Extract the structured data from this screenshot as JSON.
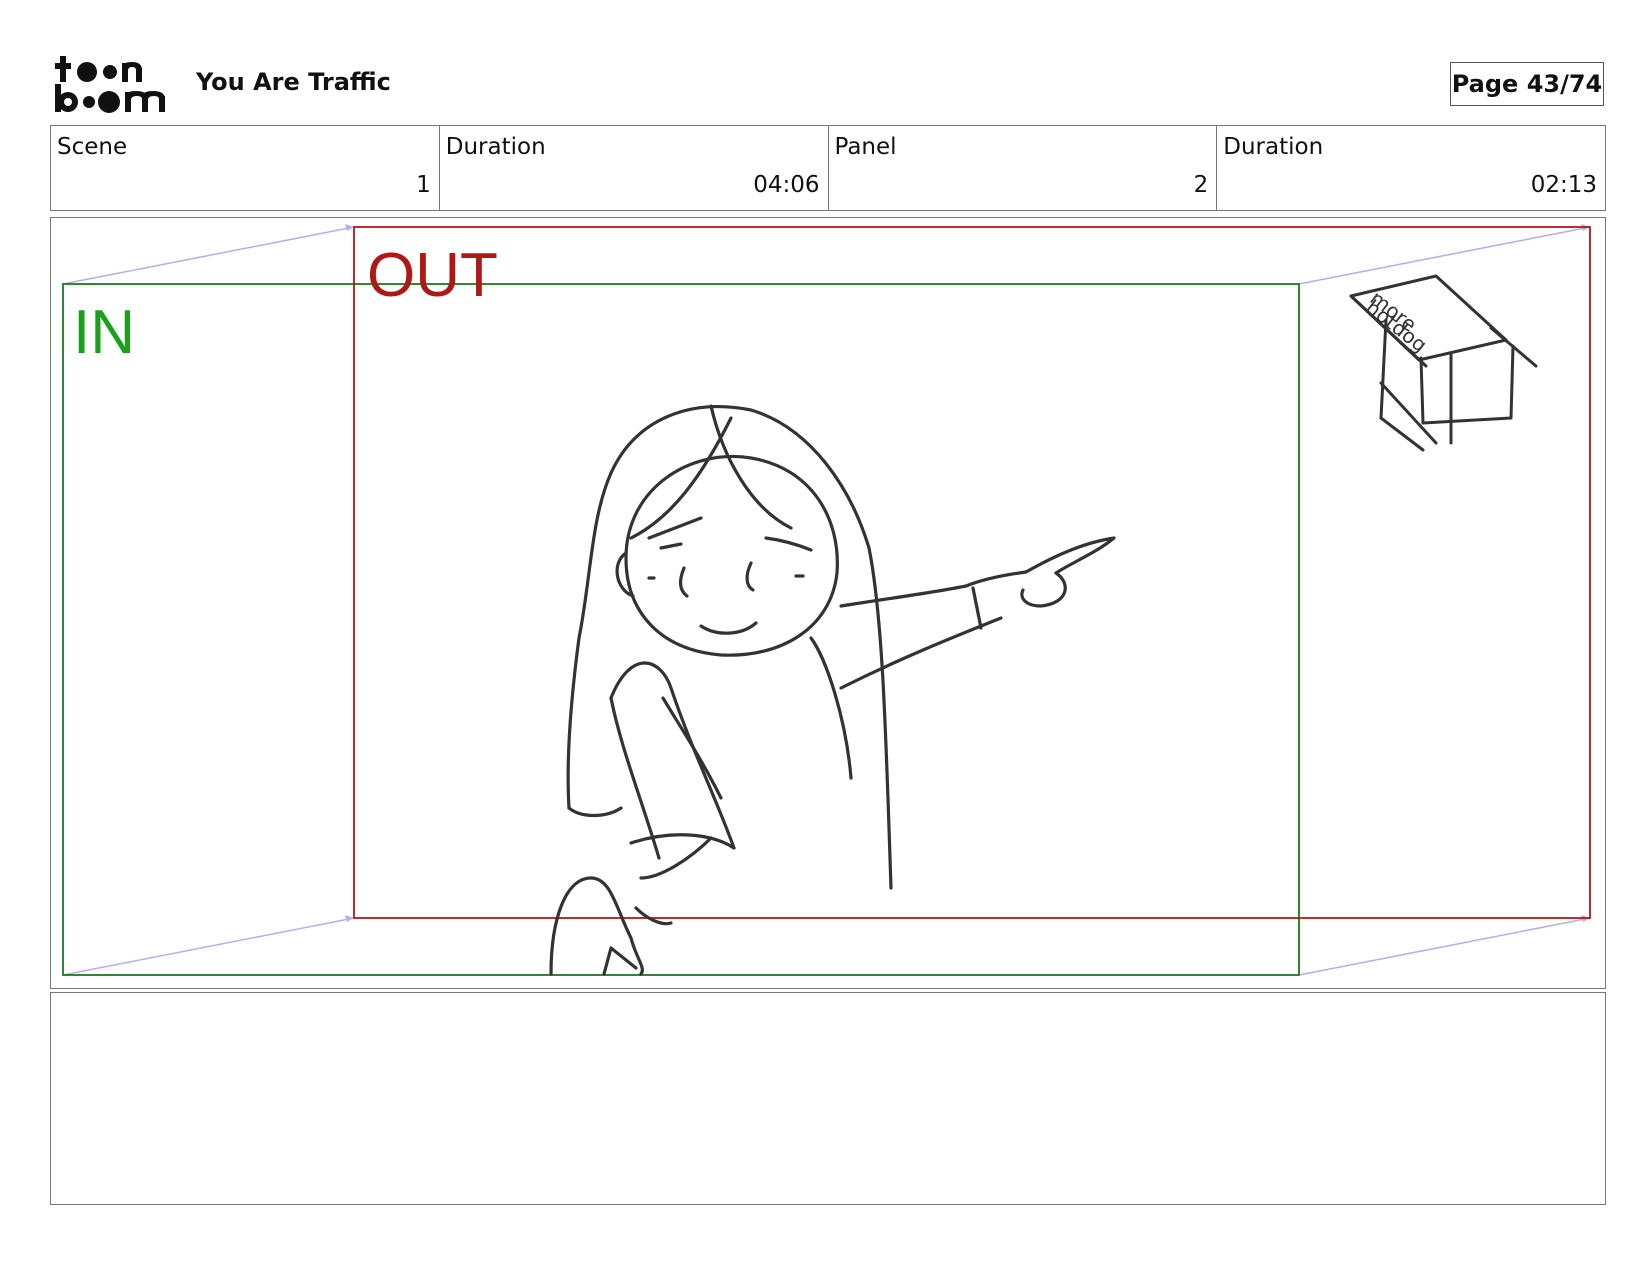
{
  "header": {
    "logo_text_top": "toon",
    "logo_text_bottom": "boom",
    "project_title": "You Are Traffic",
    "page_label": "Page 43/74"
  },
  "info": {
    "scene_label": "Scene",
    "scene_value": "1",
    "scene_duration_label": "Duration",
    "scene_duration_value": "04:06",
    "panel_label": "Panel",
    "panel_value": "2",
    "panel_duration_label": "Duration",
    "panel_duration_value": "02:13"
  },
  "panel": {
    "in_label": "IN",
    "out_label": "OUT",
    "sign_text_line1": "more",
    "sign_text_line2": "hotdog",
    "in_color": "#1a7a1a",
    "in_text_color": "#1aa01a",
    "out_color": "#b01818",
    "guide_color": "#b0b0f0"
  },
  "notes": {
    "text": ""
  }
}
